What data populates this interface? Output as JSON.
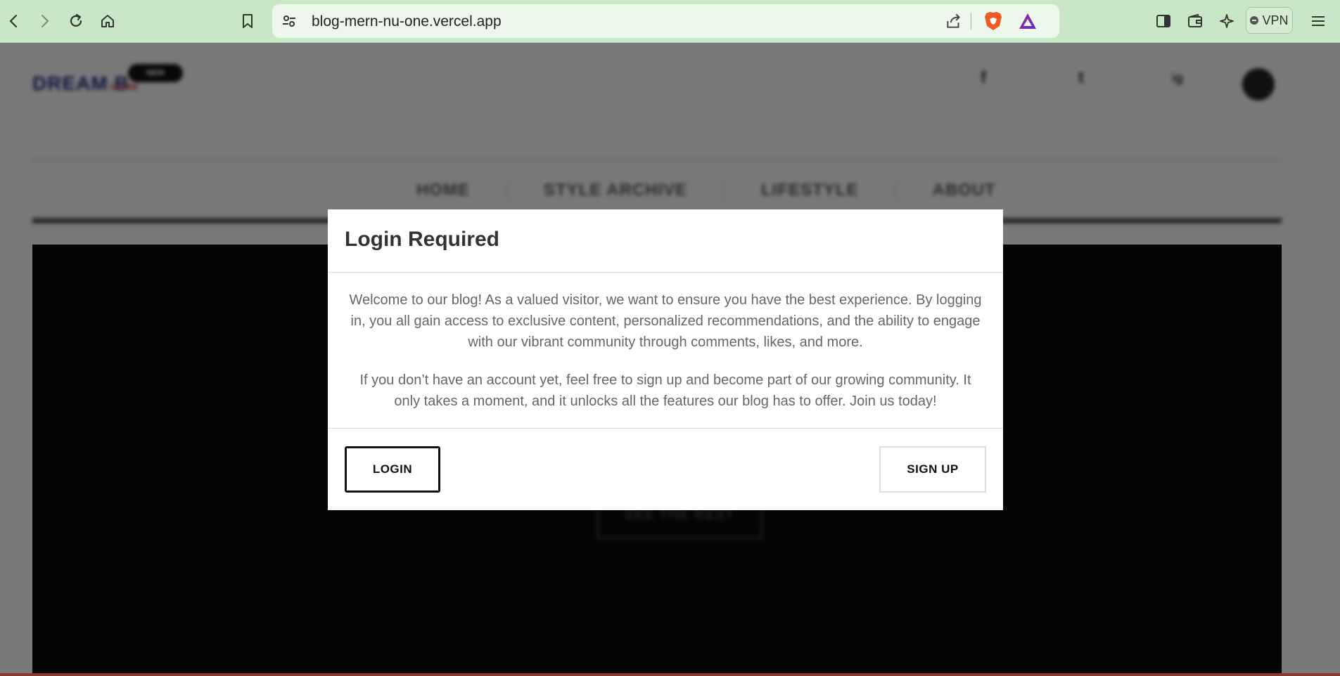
{
  "browser": {
    "url": "blog-mern-nu-one.vercel.app",
    "vpn_label": "VPN"
  },
  "site": {
    "logo": "DREAM B",
    "logo_sub": "STORE",
    "logo_badge": "NEW",
    "social": [
      "f",
      "t",
      "ig"
    ],
    "nav": [
      "HOME",
      "STYLE ARCHIVE",
      "LIFESTYLE",
      "ABOUT"
    ],
    "hero_button": "SEE THE REST"
  },
  "modal": {
    "title": "Login Required",
    "paragraph1": "Welcome to our blog! As a valued visitor, we want to ensure you have the best experience. By logging in, you all gain access to exclusive content, personalized recommendations, and the ability to engage with our vibrant community through comments, likes, and more.",
    "paragraph2": "If you don’t have an account yet, feel free to sign up and become part of our growing community. It only takes a moment, and it unlocks all the features our blog has to offer. Join us today!",
    "login_label": "LOGIN",
    "signup_label": "SIGN UP"
  }
}
